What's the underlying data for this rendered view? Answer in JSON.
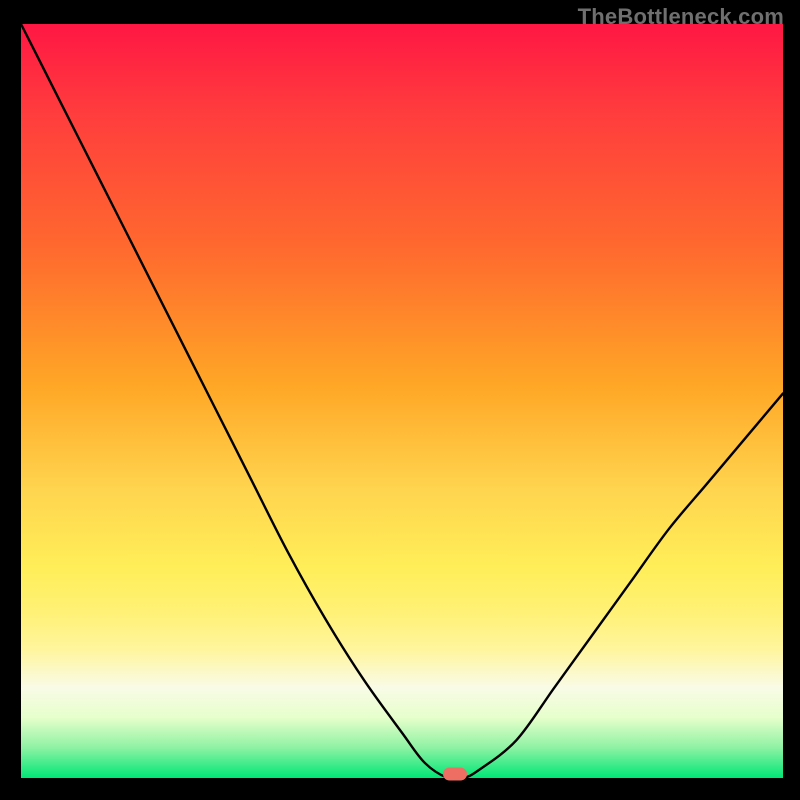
{
  "watermark": "TheBottleneck.com",
  "chart_data": {
    "type": "line",
    "title": "",
    "xlabel": "",
    "ylabel": "",
    "x": [
      0,
      5,
      10,
      15,
      20,
      25,
      30,
      35,
      40,
      45,
      50,
      53,
      56,
      58,
      60,
      65,
      70,
      75,
      80,
      85,
      90,
      95,
      100
    ],
    "values": [
      100,
      90,
      80,
      70,
      60,
      50,
      40,
      30,
      21,
      13,
      6,
      2,
      0,
      0,
      1,
      5,
      12,
      19,
      26,
      33,
      39,
      45,
      51
    ],
    "xlim": [
      0,
      100
    ],
    "ylim": [
      0,
      100
    ],
    "marker": {
      "x": 57,
      "y": 0
    },
    "gradient_stops": [
      {
        "pos": 0,
        "color": "#ff1744"
      },
      {
        "pos": 50,
        "color": "#ffee58"
      },
      {
        "pos": 100,
        "color": "#00e676"
      }
    ]
  }
}
